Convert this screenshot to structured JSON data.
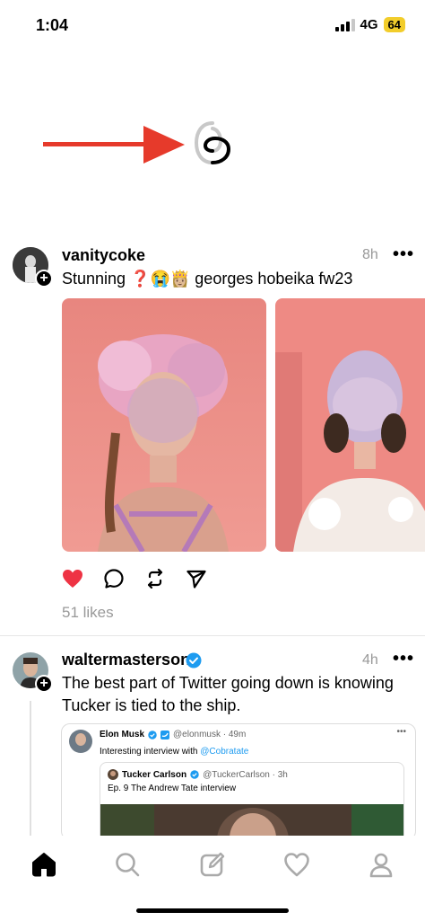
{
  "status": {
    "time": "1:04",
    "network": "4G",
    "battery": "64"
  },
  "posts": [
    {
      "username": "vanitycoke",
      "time": "8h",
      "text": "Stunning ❓😭👸🏼 georges hobeika fw23",
      "likes": "51 likes"
    },
    {
      "username": "waltermasterson",
      "time": "4h",
      "text": "The best part of Twitter going down is knowing Tucker is tied to the ship.",
      "quote": {
        "author": "Elon Musk",
        "handle": "@elonmusk · 49m",
        "text_prefix": "Interesting interview with ",
        "mention": "@Cobratate",
        "inner": {
          "author": "Tucker Carlson",
          "handle": "@TuckerCarlson · 3h",
          "text": "Ep. 9  The Andrew Tate interview"
        }
      }
    }
  ],
  "more_label": "•••",
  "colors": {
    "like_red": "#ee3344",
    "verified_blue": "#1d9bf0",
    "arrow_red": "#e63a2b"
  }
}
